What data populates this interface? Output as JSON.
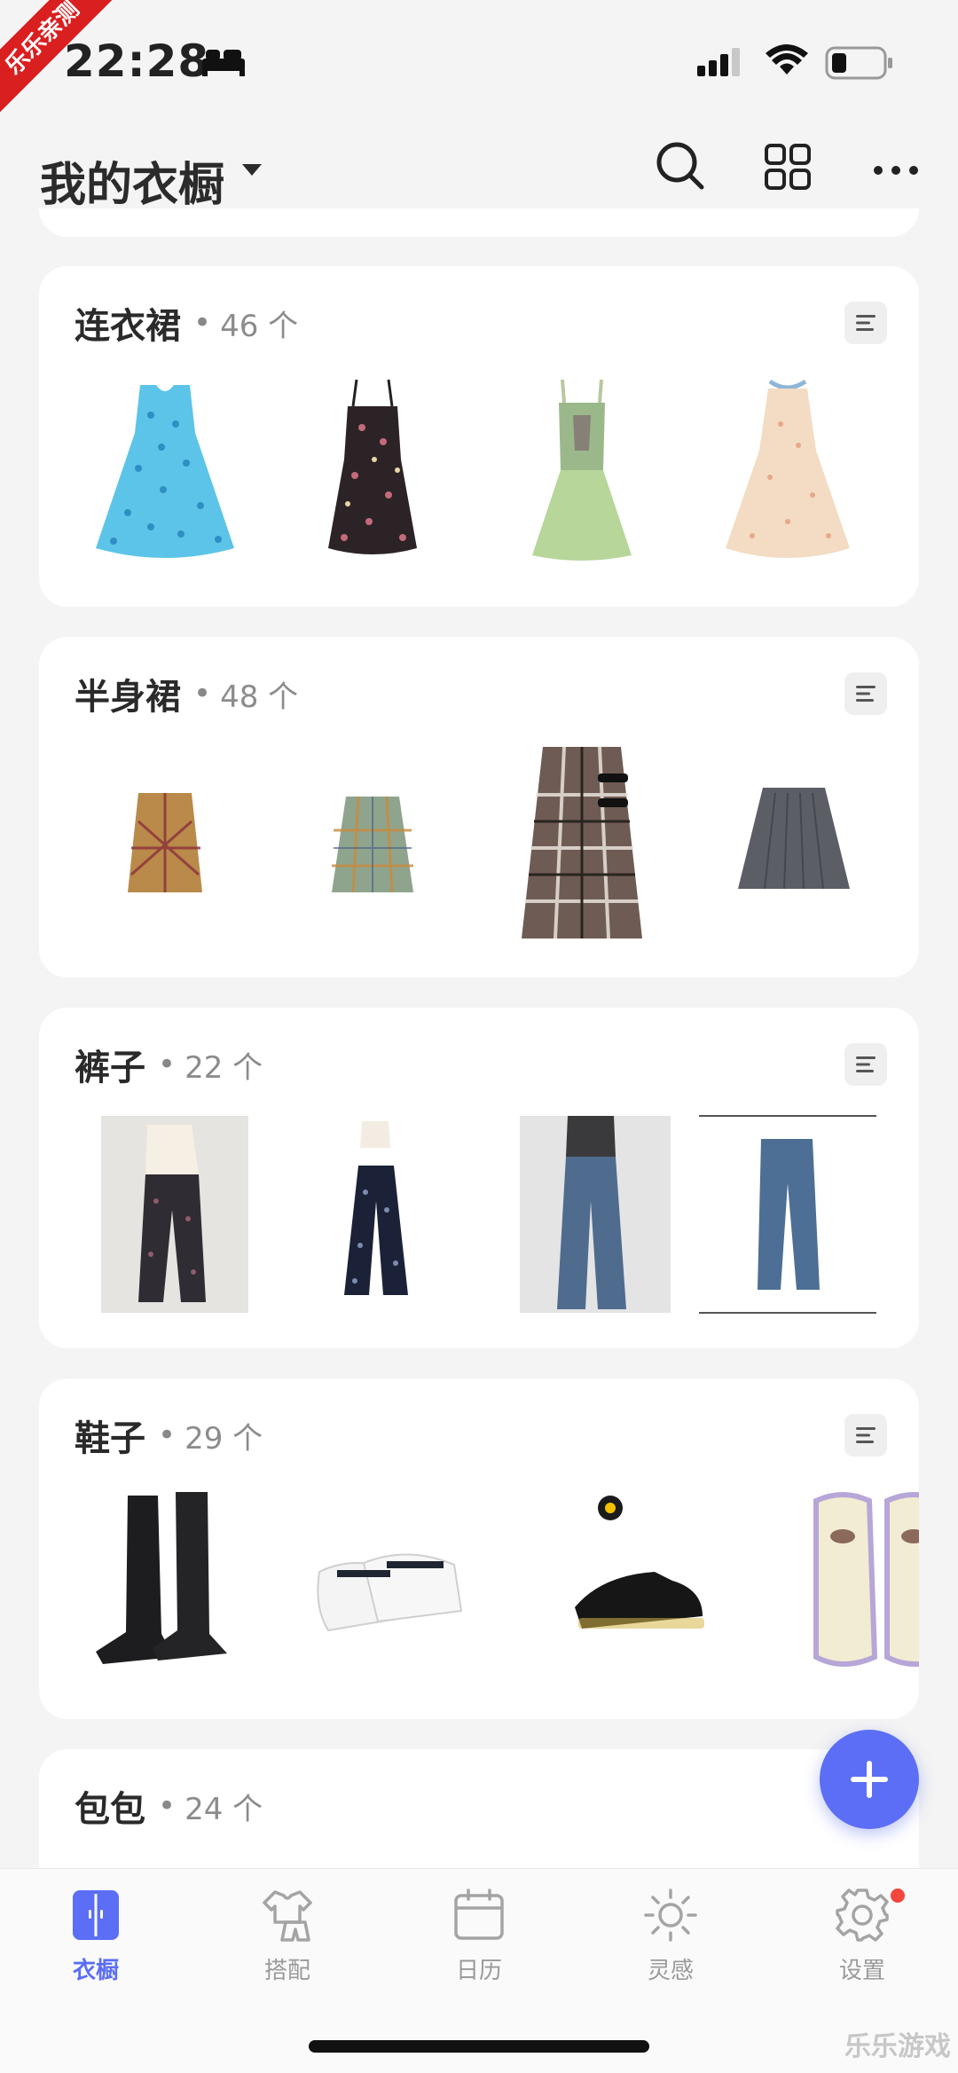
{
  "status_bar": {
    "time": "22:28",
    "corner_badge": "乐乐亲测"
  },
  "header": {
    "title": "我的衣橱"
  },
  "categories": [
    {
      "name": "连衣裙",
      "count": "46 个"
    },
    {
      "name": "半身裙",
      "count": "48 个"
    },
    {
      "name": "裤子",
      "count": "22 个"
    },
    {
      "name": "鞋子",
      "count": "29 个"
    },
    {
      "name": "包包",
      "count": "24 个"
    }
  ],
  "items": {
    "dresses": [
      "blue-polka-dot-dress",
      "black-floral-dress",
      "green-corset-dress",
      "peach-floral-dress"
    ],
    "skirts": [
      "brown-plaid-skirt",
      "green-plaid-skirt",
      "brown-plaid-kilt",
      "grey-pleated-skirt"
    ],
    "pants": [
      "dark-printed-trousers",
      "navy-dotted-trousers",
      "blue-wide-jeans",
      "blue-straight-jeans"
    ],
    "shoes": [
      "black-lace-up-boots",
      "white-mary-janes",
      "black-oxford-shoes",
      "lilac-sneakers"
    ]
  },
  "tabs": [
    {
      "label": "衣橱",
      "icon": "wardrobe-icon",
      "active": true
    },
    {
      "label": "搭配",
      "icon": "outfit-icon",
      "active": false
    },
    {
      "label": "日历",
      "icon": "calendar-icon",
      "active": false
    },
    {
      "label": "灵感",
      "icon": "sun-icon",
      "active": false
    },
    {
      "label": "设置",
      "icon": "gear-icon",
      "active": false
    }
  ],
  "watermark": "乐乐游戏",
  "colors": {
    "accent": "#5b6ef5",
    "badge": "#f2473c",
    "card_bg": "#ffffff",
    "page_bg": "#f4f4f4"
  }
}
